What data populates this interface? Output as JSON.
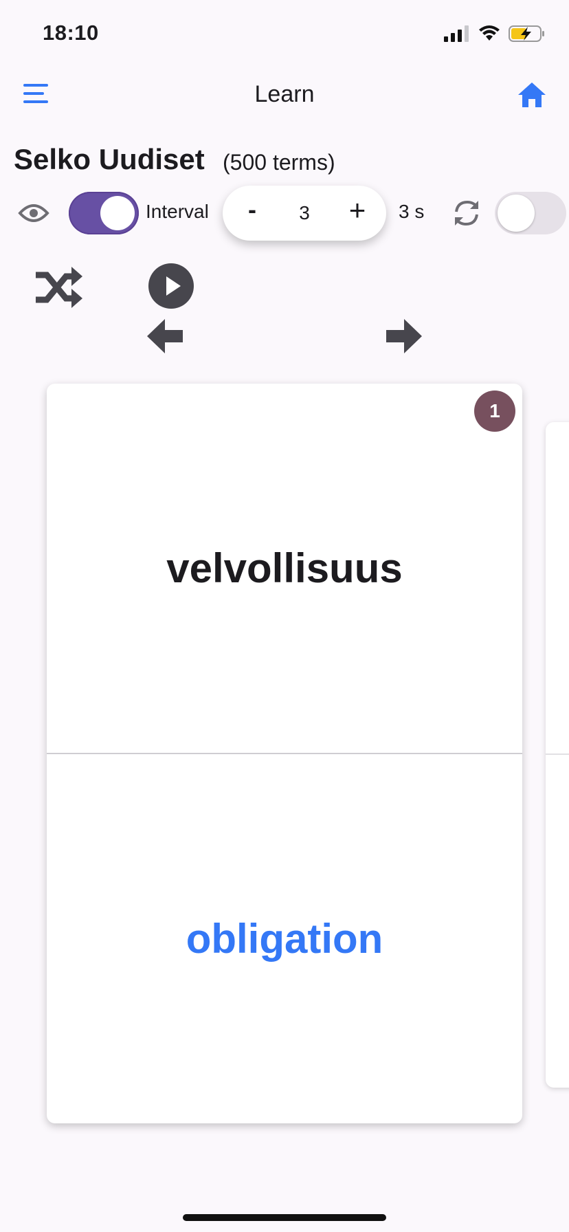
{
  "status_bar": {
    "time": "18:10"
  },
  "header": {
    "title": "Learn",
    "menu_icon": "hamburger-menu-icon",
    "home_icon": "home-icon"
  },
  "deck": {
    "name": "Selko Uudiset",
    "count": "(500 terms)"
  },
  "controls": {
    "show_answer_toggle": true,
    "interval_label": "Interval",
    "stepper": {
      "minus": "-",
      "value": "3",
      "plus": "+"
    },
    "seconds": "3 s",
    "repeat_toggle": false
  },
  "card": {
    "index": "1",
    "front": "velvollisuus",
    "back": "obligation"
  },
  "colors": {
    "accent": "#3478f6",
    "toggle_on": "#6750a4",
    "badge": "#77505e",
    "icon_dark": "#47464d"
  }
}
